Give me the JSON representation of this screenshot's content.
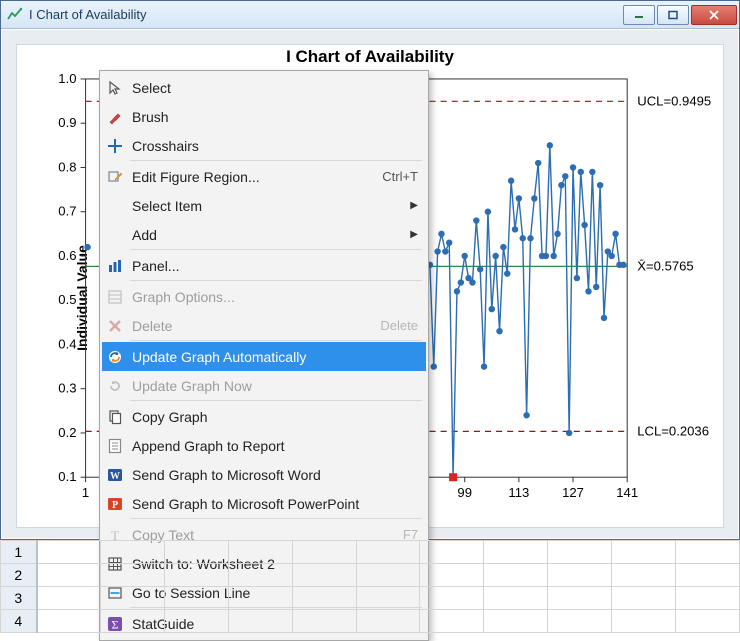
{
  "window": {
    "title": "I Chart of Availability",
    "buttons": {
      "min": "minimize",
      "max": "maximize",
      "close": "close"
    }
  },
  "chart_data": {
    "type": "line",
    "title": "I Chart of Availability",
    "xlabel": "",
    "ylabel": "Individual Value",
    "ylim": [
      0.1,
      1.0
    ],
    "yticks": [
      0.1,
      0.2,
      0.3,
      0.4,
      0.5,
      0.6,
      0.7,
      0.8,
      0.9,
      1.0
    ],
    "xticks": [
      1,
      99,
      113,
      127,
      141
    ],
    "ref_lines": {
      "ucl": {
        "value": 0.9495,
        "label": "UCL=0.9495"
      },
      "mean": {
        "value": 0.5765,
        "label": "X̄=0.5765"
      },
      "lcl": {
        "value": 0.2036,
        "label": "LCL=0.2036"
      }
    },
    "outlier": {
      "x": 96,
      "y": 0.1
    },
    "series": [
      {
        "name": "Individual",
        "x_start": 90,
        "values": [
          0.58,
          0.35,
          0.61,
          0.65,
          0.61,
          0.63,
          0.1,
          0.52,
          0.54,
          0.6,
          0.55,
          0.54,
          0.68,
          0.57,
          0.35,
          0.7,
          0.48,
          0.6,
          0.43,
          0.62,
          0.56,
          0.77,
          0.66,
          0.73,
          0.64,
          0.24,
          0.64,
          0.73,
          0.81,
          0.6,
          0.6,
          0.85,
          0.6,
          0.65,
          0.76,
          0.78,
          0.2,
          0.8,
          0.55,
          0.79,
          0.67,
          0.52,
          0.79,
          0.53,
          0.76,
          0.46,
          0.61,
          0.6,
          0.65,
          0.58,
          0.58
        ]
      }
    ]
  },
  "context_menu": {
    "items": [
      {
        "icon": "cursor-icon",
        "label": "Select",
        "sub": false
      },
      {
        "icon": "brush-icon",
        "label": "Brush",
        "sub": false
      },
      {
        "icon": "crosshair-icon",
        "label": "Crosshairs",
        "sub": false,
        "sep": true
      },
      {
        "icon": "edit-region-icon",
        "label": "Edit Figure Region...",
        "accel": "Ctrl+T"
      },
      {
        "icon": "",
        "label": "Select Item",
        "sub": true
      },
      {
        "icon": "",
        "label": "Add",
        "sub": true,
        "sep": true
      },
      {
        "icon": "bars-icon",
        "label": "Panel...",
        "sep": true
      },
      {
        "icon": "sheet-icon",
        "label": "Graph Options...",
        "disabled": true
      },
      {
        "icon": "delete-x-icon",
        "label": "Delete",
        "accel": "Delete",
        "disabled": true,
        "sep": true
      },
      {
        "icon": "refresh-icon",
        "label": "Update Graph Automatically",
        "selected": true
      },
      {
        "icon": "reload-icon",
        "label": "Update Graph Now",
        "disabled": true,
        "sep": true
      },
      {
        "icon": "copy-icon",
        "label": "Copy Graph"
      },
      {
        "icon": "append-icon",
        "label": "Append Graph to Report"
      },
      {
        "icon": "word-icon",
        "label": "Send Graph to Microsoft Word"
      },
      {
        "icon": "ppt-icon",
        "label": "Send Graph to Microsoft PowerPoint",
        "sep": true
      },
      {
        "icon": "text-t-icon",
        "label": "Copy Text",
        "accel": "F7",
        "disabled": true
      },
      {
        "icon": "grid-icon",
        "label": "Switch to: Worksheet 2"
      },
      {
        "icon": "goto-icon",
        "label": "Go to Session Line",
        "sep": true
      },
      {
        "icon": "sigma-icon",
        "label": "StatGuide"
      }
    ]
  },
  "worksheet": {
    "row_headers": [
      "1",
      "2",
      "3",
      "4"
    ]
  }
}
